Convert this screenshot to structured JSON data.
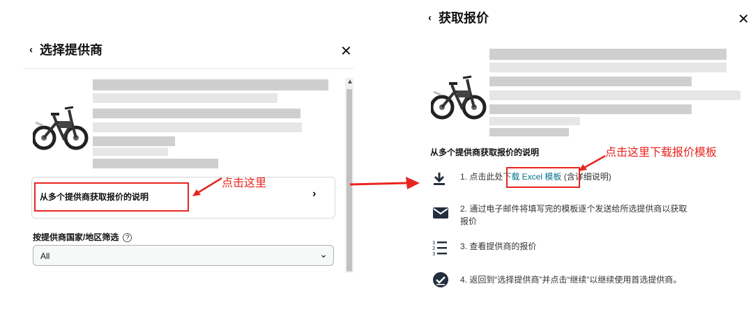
{
  "left_panel": {
    "back_icon": "chevron-left-icon",
    "title": "选择提供商",
    "close_icon": "close-x-icon",
    "instructions_label": "从多个提供商获取报价的说明",
    "instructions_chevron": "›",
    "filter_label": "按提供商国家/地区筛选",
    "filter_info_icon": "?",
    "filter_value": "All",
    "dropdown_icon": "chevron-down-icon"
  },
  "right_panel": {
    "back_icon": "chevron-left-icon",
    "title": "获取报价",
    "close_icon": "close-x-icon",
    "section_title": "从多个提供商获取报价的说明",
    "steps": [
      {
        "icon": "download-icon",
        "prefix": "1. 点击此处",
        "link": "下载 Excel 模板",
        "suffix": "(含详细说明)"
      },
      {
        "icon": "envelope-icon",
        "text": "2. 通过电子邮件将填写完的模板逐个发送给所选提供商以获取",
        "text2": "报价"
      },
      {
        "icon": "numbered-list-icon",
        "text": "3. 查看提供商的报价"
      },
      {
        "icon": "check-circle-icon",
        "text": "4. 返回到“选择提供商”并点击“继续”以继续使用首选提供商。"
      }
    ]
  },
  "annotations": {
    "click_here": "点击这里",
    "click_download": "点击这里下载报价模板",
    "color": "#e8251f"
  }
}
